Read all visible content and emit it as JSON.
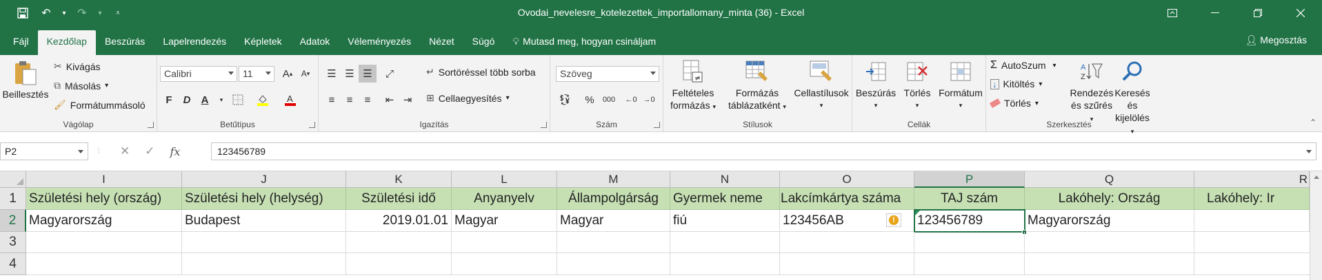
{
  "window": {
    "title": "Ovodai_nevelesre_kotelezettek_importallomany_minta (36)  -  Excel"
  },
  "tabs": [
    "Fájl",
    "Kezdőlap",
    "Beszúrás",
    "Lapelrendezés",
    "Képletek",
    "Adatok",
    "Véleményezés",
    "Nézet",
    "Súgó"
  ],
  "tell_me": "Mutasd meg, hogyan csináljam",
  "share": "Megosztás",
  "ribbon": {
    "clipboard": {
      "label": "Vágólap",
      "paste": "Beillesztés",
      "cut": "Kivágás",
      "copy": "Másolás",
      "format_painter": "Formátummásoló"
    },
    "font": {
      "label": "Betűtípus",
      "name": "Calibri",
      "size": "11",
      "bold": "F",
      "italic": "D",
      "underline": "A"
    },
    "alignment": {
      "label": "Igazítás",
      "wrap": "Sortöréssel több sorba",
      "merge": "Cellaegyesítés"
    },
    "number": {
      "label": "Szám",
      "format": "Szöveg",
      "percent": "%",
      "thousands": "000"
    },
    "styles": {
      "label": "Stílusok",
      "conditional_1": "Feltételes",
      "conditional_2": "formázás",
      "table_1": "Formázás",
      "table_2": "táblázatként",
      "cell_styles": "Cellastílusok"
    },
    "cells": {
      "label": "Cellák",
      "insert": "Beszúrás",
      "delete": "Törlés",
      "format": "Formátum"
    },
    "editing": {
      "label": "Szerkesztés",
      "autosum": "AutoSzum",
      "fill": "Kitöltés",
      "clear": "Törlés",
      "sort_1": "Rendezés",
      "sort_2": "és szűrés",
      "find_1": "Keresés és",
      "find_2": "kijelölés"
    }
  },
  "formula_bar": {
    "name_box": "P2",
    "fx": "fx",
    "value": "123456789"
  },
  "grid": {
    "columns": [
      "I",
      "J",
      "K",
      "L",
      "M",
      "N",
      "O",
      "P",
      "Q",
      "R"
    ],
    "selected_column": "P",
    "rows": [
      "1",
      "2",
      "3",
      "4"
    ],
    "selected_row": "2",
    "header_row": [
      "Születési hely (ország)",
      "Születési hely (helység)",
      "Születési idő",
      "Anyanyelv",
      "Állampolgárság",
      "Gyermek neme",
      "Lakcímkártya száma",
      "TAJ szám",
      "Lakóhely: Ország",
      "Lakóhely: Ir"
    ],
    "data_row": [
      "Magyarország",
      "Budapest",
      "2019.01.01",
      "Magyar",
      "Magyar",
      "fiú",
      "123456AB",
      "123456789",
      "Magyarország",
      ""
    ]
  }
}
